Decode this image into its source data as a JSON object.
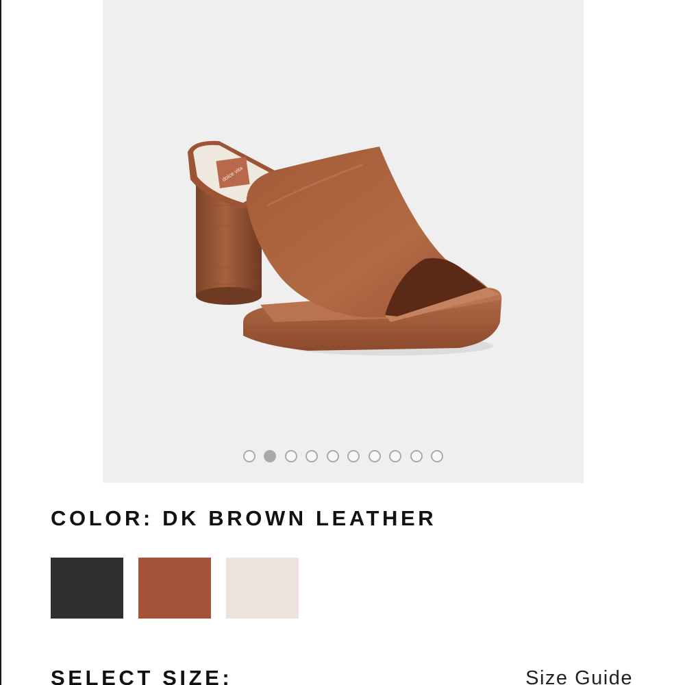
{
  "gallery": {
    "image_name": "sandal-product-photo",
    "insole_logo_text": "dolce vita",
    "dot_count": 10,
    "active_dot_index": 1
  },
  "color": {
    "heading": "COLOR: DK BROWN LEATHER",
    "swatches": [
      {
        "name": "black",
        "color": "#2f2f2f"
      },
      {
        "name": "dk-brown-leather",
        "color": "#a5543a"
      },
      {
        "name": "ivory",
        "color": "#ede2dd"
      }
    ]
  },
  "size": {
    "heading": "SELECT SIZE:",
    "guide_link": "Size Guide"
  }
}
